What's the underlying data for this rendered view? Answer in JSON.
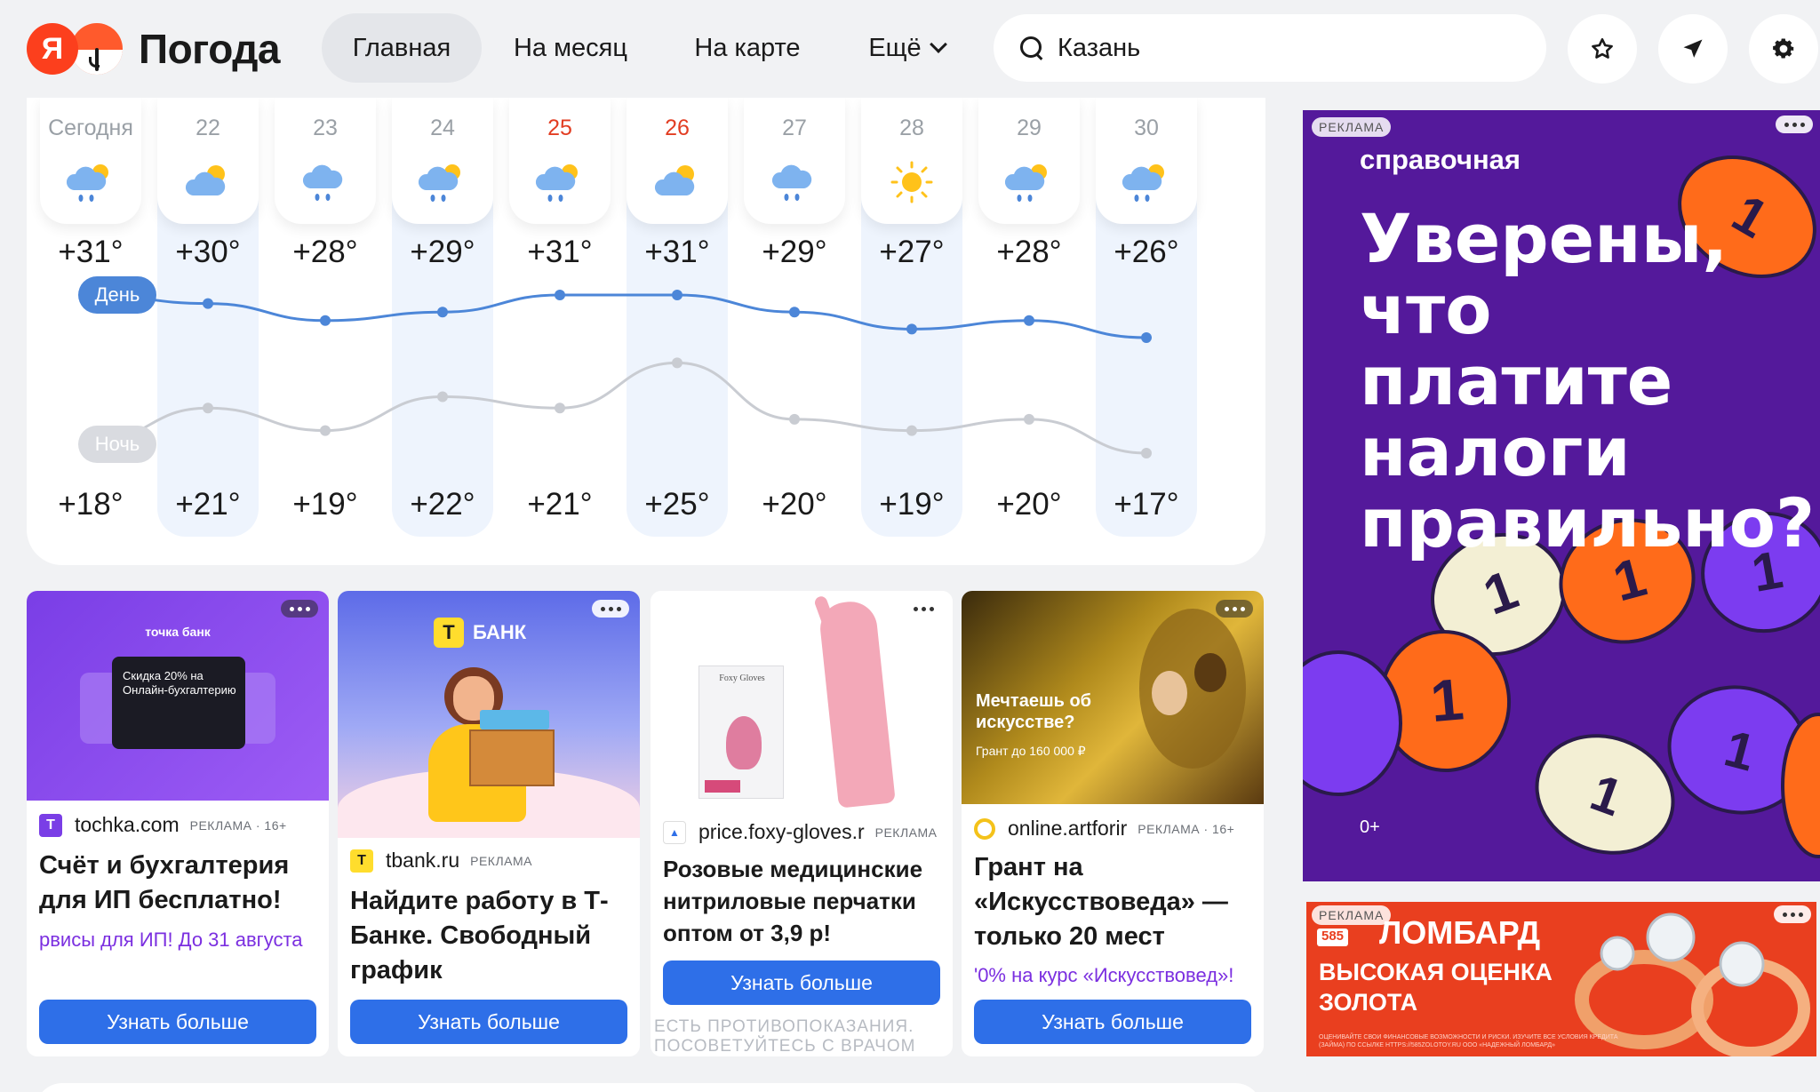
{
  "header": {
    "logo_text": "Погода",
    "logo_letter": "Я",
    "nav": {
      "main": "Главная",
      "month": "На месяц",
      "map": "На карте",
      "more": "Ещё"
    },
    "search": {
      "value": "Казань"
    }
  },
  "forecast": {
    "day_pill": "День",
    "night_pill": "Ночь",
    "days": [
      {
        "label": "Сегодня",
        "icon": "rain-cloud-sun-icon",
        "weekend": false,
        "day_temp": "+31°",
        "night_temp": "+18°",
        "day_value": 31,
        "night_value": 18
      },
      {
        "label": "22",
        "icon": "cloud-sun-icon",
        "weekend": false,
        "day_temp": "+30°",
        "night_temp": "+21°",
        "day_value": 30,
        "night_value": 21
      },
      {
        "label": "23",
        "icon": "rain-cloud-icon",
        "weekend": false,
        "day_temp": "+28°",
        "night_temp": "+19°",
        "day_value": 28,
        "night_value": 19
      },
      {
        "label": "24",
        "icon": "rain-cloud-sun-icon",
        "weekend": false,
        "day_temp": "+29°",
        "night_temp": "+22°",
        "day_value": 29,
        "night_value": 22
      },
      {
        "label": "25",
        "icon": "rain-cloud-sun-icon",
        "weekend": true,
        "day_temp": "+31°",
        "night_temp": "+21°",
        "day_value": 31,
        "night_value": 21
      },
      {
        "label": "26",
        "icon": "cloud-sun-icon",
        "weekend": true,
        "day_temp": "+31°",
        "night_temp": "+25°",
        "day_value": 31,
        "night_value": 25
      },
      {
        "label": "27",
        "icon": "rain-cloud-icon",
        "weekend": false,
        "day_temp": "+29°",
        "night_temp": "+20°",
        "day_value": 29,
        "night_value": 20
      },
      {
        "label": "28",
        "icon": "sun-icon",
        "weekend": false,
        "day_temp": "+27°",
        "night_temp": "+19°",
        "day_value": 27,
        "night_value": 19
      },
      {
        "label": "29",
        "icon": "rain-cloud-sun-icon",
        "weekend": false,
        "day_temp": "+28°",
        "night_temp": "+20°",
        "day_value": 28,
        "night_value": 20
      },
      {
        "label": "30",
        "icon": "rain-cloud-sun-icon",
        "weekend": false,
        "day_temp": "+26°",
        "night_temp": "+17°",
        "day_value": 26,
        "night_value": 17
      }
    ]
  },
  "ads": [
    {
      "image_text_1": "точка банк",
      "image_text_2": "Скидка 20% на Онлайн-бухгалтерию",
      "domain": "tochka.com",
      "tag": "РЕКЛАМА · 16+",
      "title": "Счёт и бухгалтерия для ИП бесплатно!",
      "sub": "рвисы для ИП! До 31 августа",
      "button": "Узнать больше"
    },
    {
      "image_text_1": "БАНК",
      "domain": "tbank.ru",
      "tag": "РЕКЛАМА",
      "title": "Найдите работу в Т-Банке. Свободный график",
      "button": "Узнать больше"
    },
    {
      "image_text_1": "Foxy Gloves",
      "domain": "price.foxy-gloves.r",
      "tag": "РЕКЛАМА",
      "title": "Розовые медицинские нитриловые перчатки оптом от 3,9 р!",
      "button": "Узнать больше",
      "disclaimer": "ЕСТЬ ПРОТИВОПОКАЗАНИЯ. ПОСОВЕТУЙТЕСЬ С ВРАЧОМ"
    },
    {
      "image_text_1": "Мечтаешь об искусстве?",
      "image_text_2": "Грант до 160 000 ₽",
      "domain": "online.artforir",
      "tag": "РЕКЛАМА · 16+",
      "title": "Грант на «Искусствоведа» — только 20 мест",
      "sub": "'0% на курс «Искусствовед»!",
      "button": "Узнать больше"
    }
  ],
  "big_ad": {
    "label": "РЕКЛАМА",
    "brand": "справочная",
    "headline": "Уверены, что платите налоги правильно?",
    "age": "0+"
  },
  "lombard_ad": {
    "label": "РЕКЛАМА",
    "badge": "585",
    "brand": "ЛОМБАРД",
    "headline": "ВЫСОКАЯ ОЦЕНКА ЗОЛОТА",
    "fine_print": "ОЦЕНИВАЙТЕ СВОИ ФИНАНСОВЫЕ ВОЗМОЖНОСТИ И РИСКИ. ИЗУЧИТЕ ВСЕ УСЛОВИЯ КРЕДИТА (ЗАЙМА) ПО ССЫЛКЕ HTTPS://585ZOLOTOY.RU ООО «НАДЕЖНЫЙ ЛОМБАРД»"
  },
  "colors": {
    "accent_blue": "#2e6fe8",
    "day_line": "#4c86d8",
    "night_line": "#c9ccd2",
    "weekend_red": "#e23d22",
    "big_ad_bg": "#54199b",
    "lombard_bg": "#e93f1f"
  }
}
